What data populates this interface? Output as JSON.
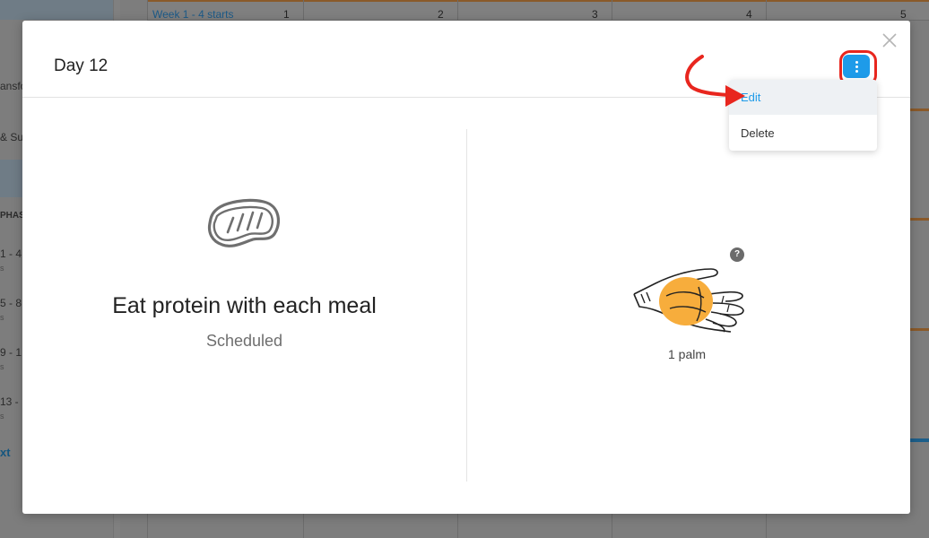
{
  "background": {
    "sidebar": {
      "items": [
        {
          "label": "ansfo"
        },
        {
          "label": "& Su"
        }
      ],
      "phase_heading": "PHAS",
      "phases": [
        {
          "label": "1 - 4",
          "sub": "s"
        },
        {
          "label": "5 - 8",
          "sub": "s"
        },
        {
          "label": "9 - 1",
          "sub": "s"
        },
        {
          "label": "13 -",
          "sub": "s"
        }
      ],
      "next_label": "xt"
    },
    "calendar": {
      "week_label": "Week 1 - 4 starts",
      "day_numbers": [
        "1",
        "2",
        "3",
        "4",
        "5"
      ]
    }
  },
  "modal": {
    "title": "Day 12",
    "menu": {
      "items": [
        {
          "label": "Edit",
          "state": "hover"
        },
        {
          "label": "Delete"
        }
      ]
    },
    "habit": {
      "icon": "steak-icon",
      "title": "Eat protein with each meal",
      "status": "Scheduled"
    },
    "portion": {
      "icon": "palm-icon",
      "help_label": "?",
      "label": "1 palm"
    }
  },
  "colors": {
    "accent": "#1e9be9",
    "annotation": "#e8261e",
    "palm_fill": "#f7ad3c",
    "background_orange": "#8a5a2a"
  }
}
